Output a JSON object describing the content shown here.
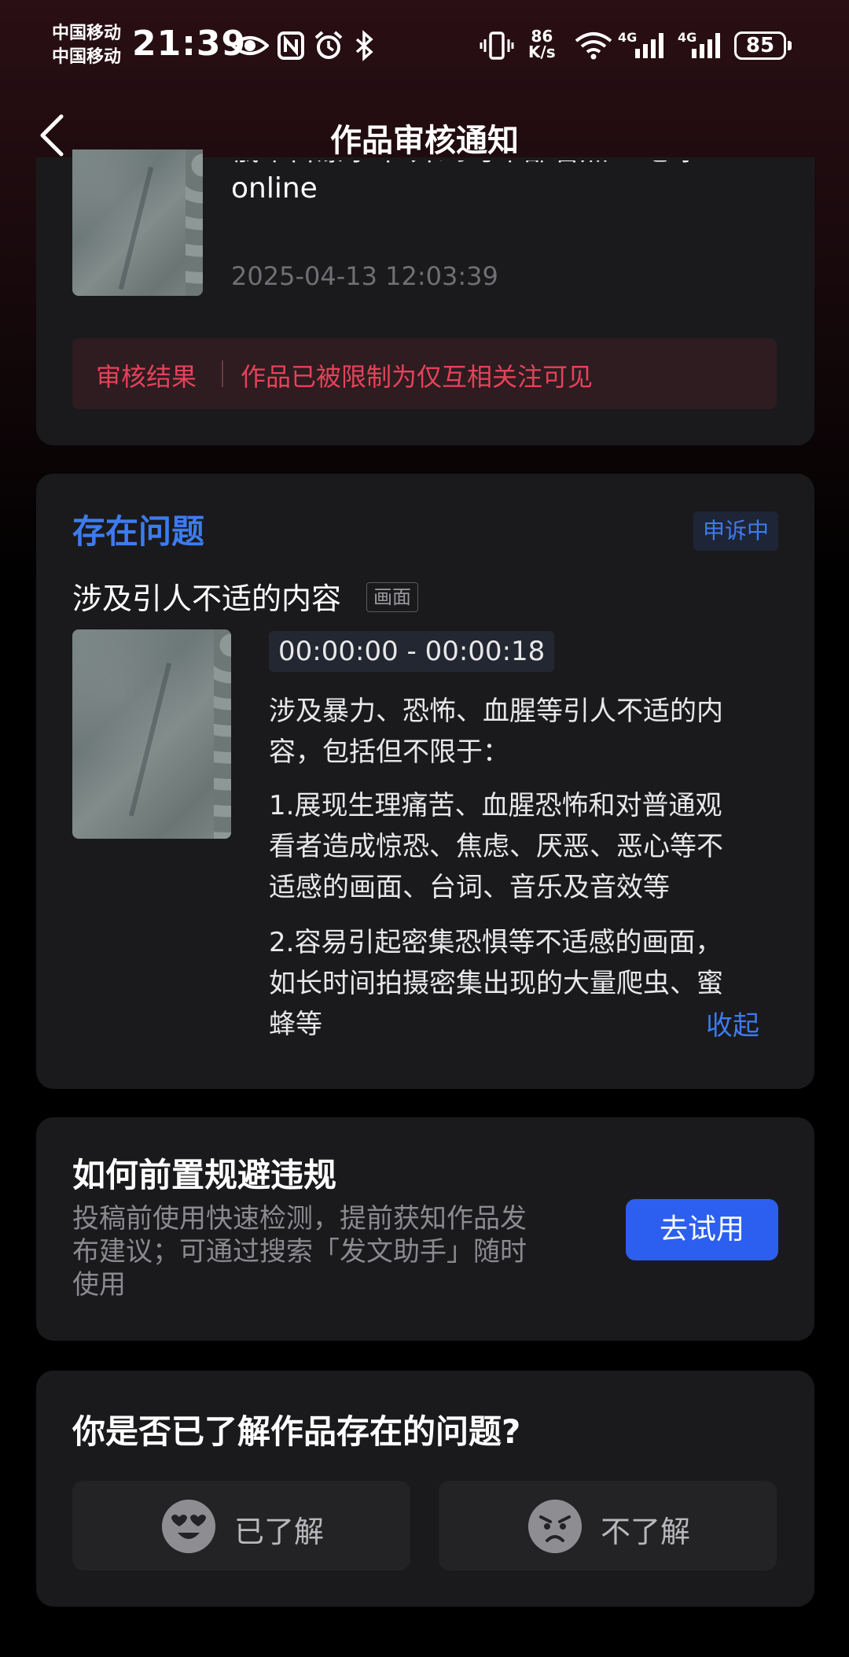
{
  "status_bar": {
    "carrier_1": "中国移动",
    "carrier_2": "中国移动",
    "time": "21:39",
    "net_speed_value": "86",
    "net_speed_unit": "K/s",
    "network_1": "4G",
    "network_2": "4G",
    "battery": "85",
    "icons": [
      "eye-icon",
      "nfc-icon",
      "alarm-icon",
      "bluetooth-icon",
      "vibrate-icon",
      "wifi-icon",
      "signal-icon",
      "battery-icon"
    ]
  },
  "nav": {
    "title": "作品审核通知",
    "back_icon": "chevron-left-icon"
  },
  "work": {
    "title_line1": "俄军百瀑水车 开到马军部看点 #地球",
    "title_line2": "online",
    "timestamp": "2025-04-13 12:03:39",
    "result_label": "审核结果",
    "result_text": "作品已被限制为仅互相关注可见"
  },
  "issue": {
    "heading": "存在问题",
    "status": "申诉中",
    "name": "涉及引人不适的内容",
    "tag": "画面",
    "time_range": "00:00:00 - 00:00:18",
    "desc_intro_1": "涉及暴力、恐怖、血腥等引人不适的内",
    "desc_intro_2": "容，包括但不限于：",
    "point1_1": "1.展现生理痛苦、血腥恐怖和对普通观",
    "point1_2": "看者造成惊恐、焦虑、厌恶、恶心等不",
    "point1_3": "适感的画面、台词、音乐及音效等",
    "point2_1": "2.容易引起密集恐惧等不适感的画面，",
    "point2_2": "如长时间拍摄密集出现的大量爬虫、蜜",
    "point2_3": "蜂等",
    "collapse": "收起"
  },
  "avoid": {
    "heading": "如何前置规避违规",
    "desc_1": "投稿前使用快速检测，提前获知作品发",
    "desc_2": "布建议；可通过搜索「发文助手」随时",
    "desc_3": "使用",
    "button": "去试用"
  },
  "feedback": {
    "question": "你是否已了解作品存在的问题?",
    "yes_label": "已了解",
    "no_label": "不了解",
    "yes_icon": "heart-eyes-face-icon",
    "no_icon": "sad-face-icon"
  },
  "colors": {
    "accent_blue": "#3d7bf0",
    "button_blue": "#2c5ff0",
    "warning_red": "#e6425a",
    "card_bg": "#1a1a1c"
  }
}
